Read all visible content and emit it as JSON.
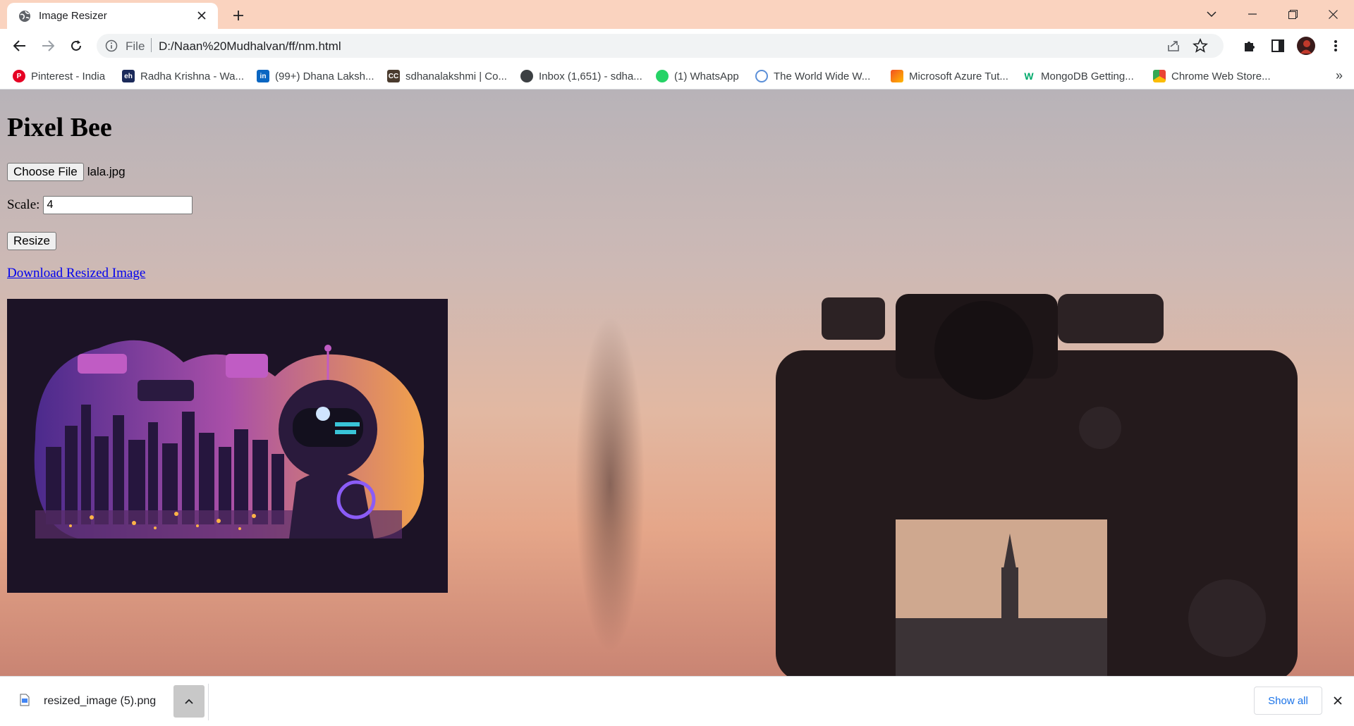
{
  "browser": {
    "tab": {
      "title": "Image Resizer",
      "favicon": "globe-icon"
    },
    "address": {
      "scheme": "File",
      "url": "D:/Naan%20Mudhalvan/ff/nm.html"
    },
    "bookmarks": [
      {
        "label": "Pinterest - India",
        "icon": "pinterest-icon",
        "color": "#e60023",
        "glyph": "P"
      },
      {
        "label": "Radha Krishna - Wa...",
        "icon": "site-icon",
        "color": "#1b2a5a",
        "glyph": "eh"
      },
      {
        "label": "(99+) Dhana Laksh...",
        "icon": "linkedin-icon",
        "color": "#0a66c2",
        "glyph": "in"
      },
      {
        "label": "sdhanalakshmi | Co...",
        "icon": "coursera-icon",
        "color": "#4a3b2e",
        "glyph": "CC"
      },
      {
        "label": "Inbox (1,651) - sdha...",
        "icon": "globe-icon",
        "color": "#3c4043",
        "glyph": ""
      },
      {
        "label": "(1) WhatsApp",
        "icon": "whatsapp-icon",
        "color": "#25d366",
        "glyph": ""
      },
      {
        "label": "The World Wide W...",
        "icon": "search-icon",
        "color": "#5b8fd8",
        "glyph": ""
      },
      {
        "label": "Microsoft Azure Tut...",
        "icon": "azure-icon",
        "color": "#f25022",
        "glyph": ""
      },
      {
        "label": "MongoDB Getting...",
        "icon": "w3schools-icon",
        "color": "#04aa6d",
        "glyph": "W"
      },
      {
        "label": "Chrome Web Store...",
        "icon": "chrome-webstore-icon",
        "color": "#ea4335",
        "glyph": ""
      }
    ]
  },
  "page": {
    "heading": "Pixel Bee",
    "file_button": "Choose File",
    "file_name": "lala.jpg",
    "scale_label": "Scale:",
    "scale_value": "4",
    "resize_button": "Resize",
    "download_link": "Download Resized Image"
  },
  "downloads": {
    "file": "resized_image (5).png",
    "show_all": "Show all"
  },
  "colors": {
    "tabstrip": "#fad3bf",
    "link": "#0000ee",
    "show_all": "#1a73e8"
  }
}
